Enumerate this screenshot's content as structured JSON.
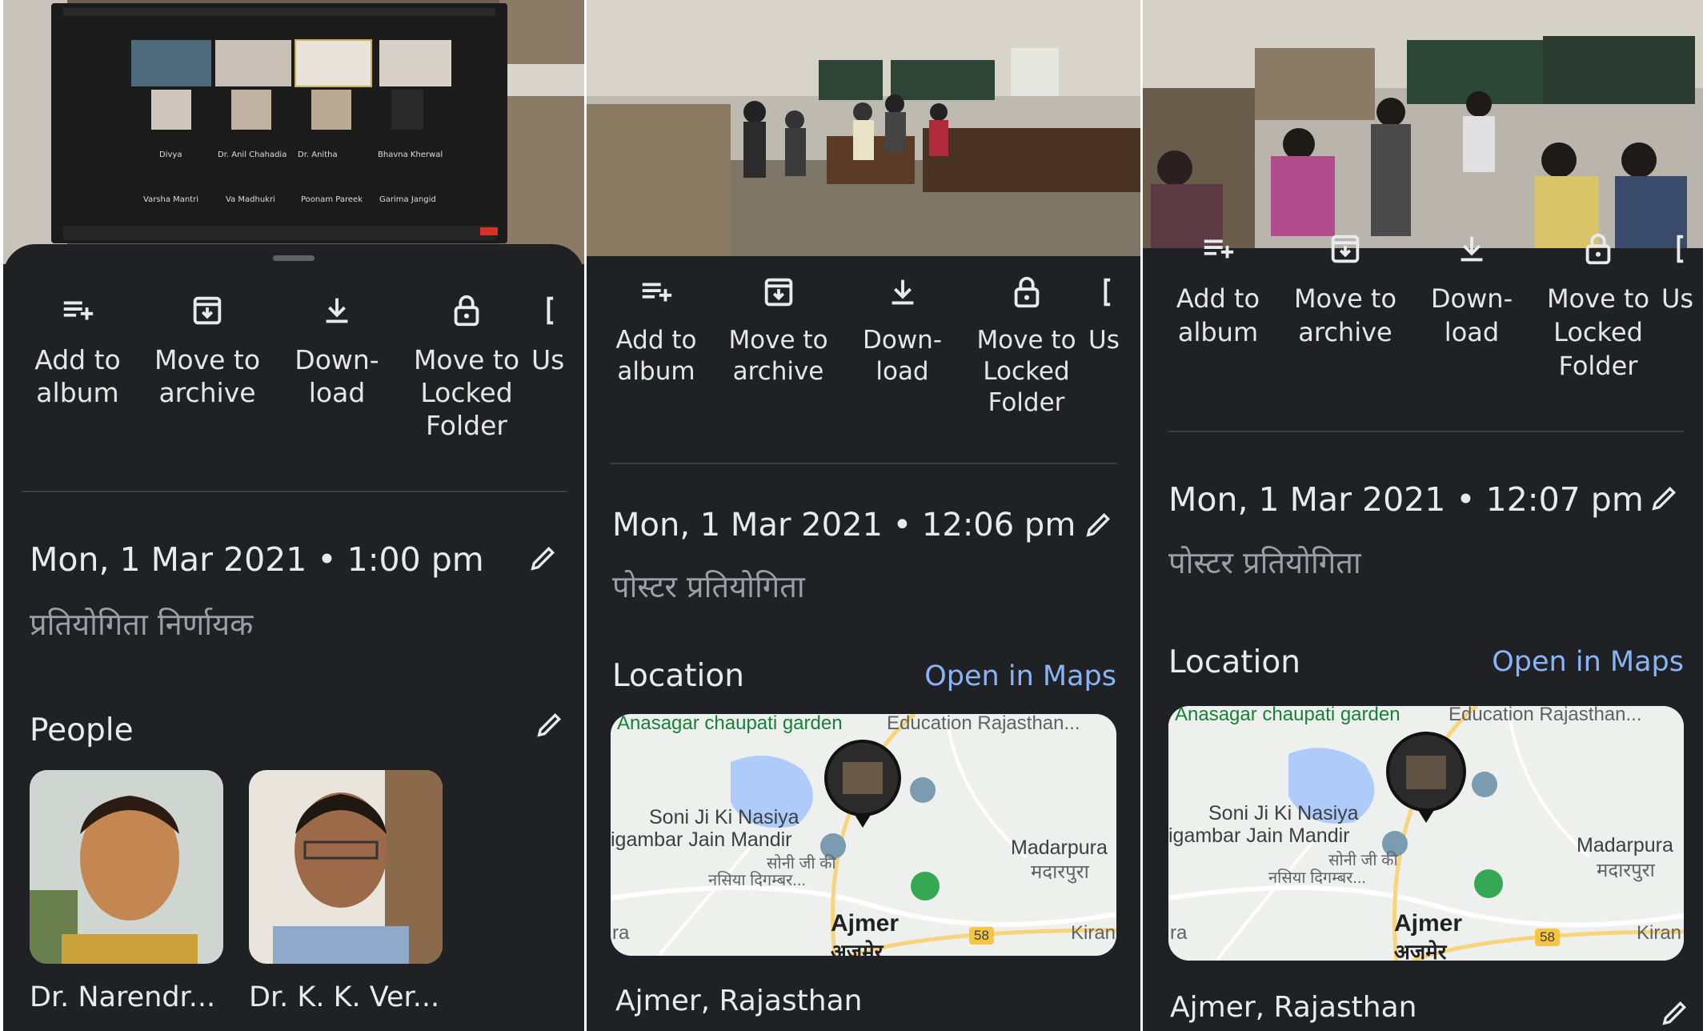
{
  "colors": {
    "sheet_bg": "#202124",
    "text_primary": "#e8eaed",
    "text_secondary": "#9aa0a6",
    "link": "#8ab4f8",
    "divider": "#3c4043"
  },
  "icons": [
    "add-to-album-icon",
    "archive-icon",
    "download-icon",
    "lock-icon",
    "edit-pencil-icon",
    "map-pin-icon",
    "landmark-icon",
    "park-icon"
  ],
  "panels": [
    {
      "actions": [
        {
          "label": "Add to\nalbum",
          "icon": "add-to-album-icon"
        },
        {
          "label": "Move to\narchive",
          "icon": "archive-icon"
        },
        {
          "label": "Down-\nload",
          "icon": "download-icon"
        },
        {
          "label": "Move to\nLocked\nFolder",
          "icon": "lock-icon"
        },
        {
          "label": "Us",
          "icon": "use-as-icon"
        }
      ],
      "datetime": "Mon, 1 Mar 2021  •  1:00 pm",
      "description": "प्रतियोगिता निर्णायक",
      "people_title": "People",
      "people": [
        {
          "name": "Dr. Narendr..."
        },
        {
          "name": "Dr. K. K. Ver..."
        }
      ],
      "video_call": {
        "tiles": [
          "Divya",
          "Dr. Anil Chahadia",
          "Dr. Anitha",
          "Bhavna Kherwal",
          "Varsha Mantri",
          "Va Madhukri",
          "Poonam Pareek",
          "Garima Jangid"
        ]
      }
    },
    {
      "actions": [
        {
          "label": "Add to\nalbum",
          "icon": "add-to-album-icon"
        },
        {
          "label": "Move to\narchive",
          "icon": "archive-icon"
        },
        {
          "label": "Down-\nload",
          "icon": "download-icon"
        },
        {
          "label": "Move to\nLocked\nFolder",
          "icon": "lock-icon"
        },
        {
          "label": "Us",
          "icon": "use-as-icon"
        }
      ],
      "datetime": "Mon, 1 Mar 2021  •  12:06 pm",
      "description": "पोस्टर प्रतियोगिता",
      "location_title": "Location",
      "open_in_maps": "Open in Maps",
      "place": "Ajmer, Rajasthan",
      "map": {
        "labels": [
          "Anasagar chaupati garden",
          "Education Rajasthan...",
          "Soni Ji Ki Nasiya",
          "igambar Jain Mandir",
          "सोनी जी की",
          "नसिया दिगम्बर...",
          "Madarpura",
          "मदारपुरा",
          "Ajmer",
          "अजमेर",
          "Kiran",
          "ra",
          "58"
        ]
      }
    },
    {
      "actions": [
        {
          "label": "Add to\nalbum",
          "icon": "add-to-album-icon"
        },
        {
          "label": "Move to\narchive",
          "icon": "archive-icon"
        },
        {
          "label": "Down-\nload",
          "icon": "download-icon"
        },
        {
          "label": "Move to\nLocked\nFolder",
          "icon": "lock-icon"
        },
        {
          "label": "Us",
          "icon": "use-as-icon"
        }
      ],
      "datetime": "Mon, 1 Mar 2021  •  12:07 pm",
      "description": "पोस्टर प्रतियोगिता",
      "location_title": "Location",
      "open_in_maps": "Open in Maps",
      "place": "Ajmer, Rajasthan",
      "map": {
        "labels": [
          "Anasagar chaupati garden",
          "Education Rajasthan...",
          "Soni Ji Ki Nasiya",
          "igambar Jain Mandir",
          "सोनी जी की",
          "नसिया दिगम्बर...",
          "Madarpura",
          "मदारपुरा",
          "Ajmer",
          "अजमेर",
          "Kiran",
          "ra",
          "58"
        ]
      }
    }
  ]
}
